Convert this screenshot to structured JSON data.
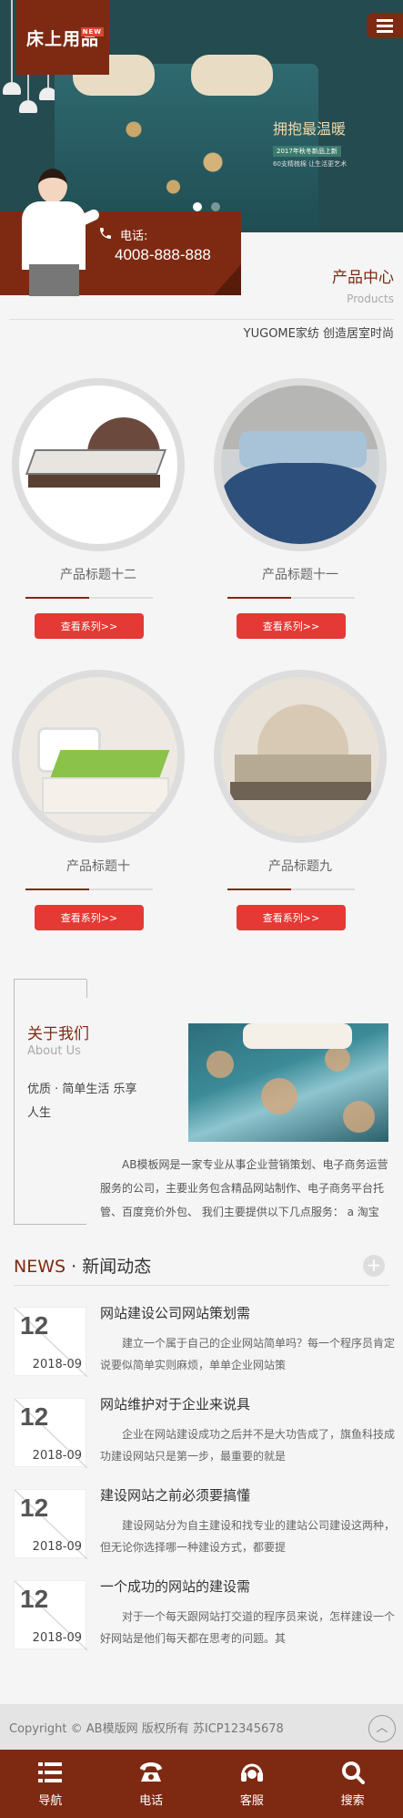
{
  "header": {
    "logo_text": "床上用品",
    "logo_badge": "NEW",
    "menu_icon": "hamburger-menu-icon"
  },
  "banner": {
    "slogan": "拥抱最温暖",
    "sub1": "2017年秋冬新品上新",
    "sub2": "60支精梳棉  让生活更艺术"
  },
  "contact": {
    "label": "电话:",
    "number": "4008-888-888",
    "icon": "phone-icon"
  },
  "products": {
    "title": "产品中心",
    "title_en": "Products",
    "slogan": "YUGOME家纺 创造居室时尚",
    "items": [
      {
        "title": "产品标题十二",
        "button": "查看系列>>"
      },
      {
        "title": "产品标题十一",
        "button": "查看系列>>"
      },
      {
        "title": "产品标题十",
        "button": "查看系列>>"
      },
      {
        "title": "产品标题九",
        "button": "查看系列>>"
      }
    ]
  },
  "about": {
    "title": "关于我们",
    "title_en": "About Us",
    "tagline": "优质 · 简单生活 乐享人生",
    "text": "AB模板网是一家专业从事企业营销策划、电子商务运营服务的公司，主要业务包含精品网站制作、电子商务平台托管、百度竞价外包、 我们主要提供以下几点服务： a 淘宝"
  },
  "news": {
    "title_en": "NEWS",
    "title_cn": "· 新闻动态",
    "more_icon": "plus-icon",
    "items": [
      {
        "day": "12",
        "ym": "2018-09",
        "title": "网站建设公司网站策划需",
        "desc": "建立一个属于自己的企业网站简单吗？每一个程序员肯定说要似简单实则麻烦，单单企业网站策"
      },
      {
        "day": "12",
        "ym": "2018-09",
        "title": "网站维护对于企业来说具",
        "desc": "企业在网站建设成功之后并不是大功告成了，旗鱼科技成功建设网站只是第一步，最重要的就是"
      },
      {
        "day": "12",
        "ym": "2018-09",
        "title": "建设网站之前必须要搞懂",
        "desc": "建设网站分为自主建设和找专业的建站公司建设这两种，但无论你选择哪一种建设方式，都要提"
      },
      {
        "day": "12",
        "ym": "2018-09",
        "title": "一个成功的网站的建设需",
        "desc": "对于一个每天跟网站打交道的程序员来说，怎样建设一个好网站是他们每天都在思考的问题。其"
      }
    ]
  },
  "footer": {
    "copyright": "Copyright © AB模版网 版权所有 苏ICP12345678",
    "top_icon": "back-to-top-icon"
  },
  "bottom_nav": [
    {
      "label": "导航",
      "icon": "list-icon"
    },
    {
      "label": "电话",
      "icon": "telephone-icon"
    },
    {
      "label": "客服",
      "icon": "headset-icon"
    },
    {
      "label": "搜索",
      "icon": "search-icon"
    }
  ],
  "colors": {
    "brand": "#7e2a12",
    "button": "#e53935",
    "banner_bg": "#244b4f"
  }
}
